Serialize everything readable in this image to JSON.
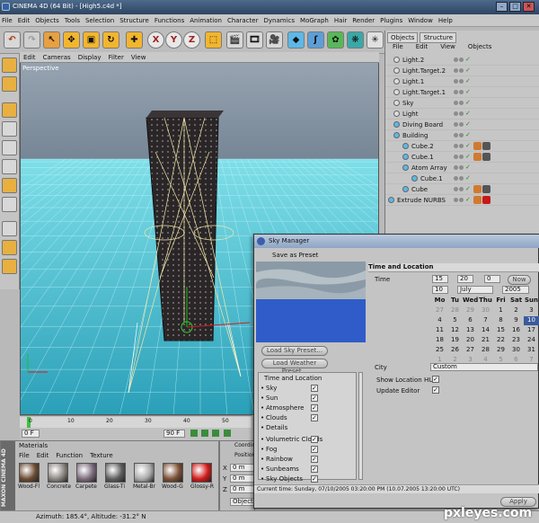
{
  "app": {
    "title": "CINEMA 4D (64 Bit) - [High5.c4d *]"
  },
  "menu": [
    "File",
    "Edit",
    "Objects",
    "Tools",
    "Selection",
    "Structure",
    "Functions",
    "Animation",
    "Character",
    "Dynamics",
    "MoGraph",
    "Hair",
    "Render",
    "Plugins",
    "Window",
    "Help"
  ],
  "toolbar": {
    "x": "X",
    "y": "Y",
    "z": "Z"
  },
  "viewport": {
    "menu": [
      "Edit",
      "Cameras",
      "Display",
      "Filter",
      "View"
    ],
    "label": "Perspective"
  },
  "objects_panel": {
    "tabs": [
      "Objects",
      "Structure"
    ],
    "menu": [
      "File",
      "Edit",
      "View",
      "Objects"
    ],
    "items": [
      {
        "name": "Light.2"
      },
      {
        "name": "Light.Target.2"
      },
      {
        "name": "Light.1"
      },
      {
        "name": "Light.Target.1"
      },
      {
        "name": "Sky"
      },
      {
        "name": "Light"
      },
      {
        "name": "Diving Board"
      },
      {
        "name": "Building"
      },
      {
        "name": "Cube.2"
      },
      {
        "name": "Cube.1"
      },
      {
        "name": "Atom Array"
      },
      {
        "name": "Cube.1"
      },
      {
        "name": "Cube"
      },
      {
        "name": "Extrude NURBS"
      }
    ]
  },
  "sky_manager": {
    "title": "Sky Manager",
    "save_preset": "Save as Preset",
    "load_sky": "Load Sky Preset...",
    "load_weather": "Load Weather Preset...",
    "section_left": "Time and Location",
    "left_items": [
      "Sky",
      "Sun",
      "Atmosphere",
      "Clouds",
      "Details"
    ],
    "left_items2": [
      "Volumetric Clouds",
      "Fog",
      "Rainbow",
      "Sunbeams",
      "Sky Objects"
    ],
    "time_loc_header": "Time and Location",
    "time_label": "Time",
    "time": {
      "h": "15",
      "m": "20",
      "s": "0"
    },
    "now_button": "Now",
    "date": {
      "day": "10",
      "month": "July",
      "year": "2005"
    },
    "weekdays": [
      "Mo",
      "Tu",
      "Wed",
      "Thu",
      "Fri",
      "Sat",
      "Sun"
    ],
    "calendar": [
      [
        "27",
        "28",
        "29",
        "30",
        "1",
        "2",
        "3"
      ],
      [
        "4",
        "5",
        "6",
        "7",
        "8",
        "9",
        "10"
      ],
      [
        "11",
        "12",
        "13",
        "14",
        "15",
        "16",
        "17"
      ],
      [
        "18",
        "19",
        "20",
        "21",
        "22",
        "23",
        "24"
      ],
      [
        "25",
        "26",
        "27",
        "28",
        "29",
        "30",
        "31"
      ],
      [
        "1",
        "2",
        "3",
        "4",
        "5",
        "6",
        "7"
      ]
    ],
    "city_label": "City",
    "city_value": "Custom",
    "show_hud": "Show Location HUD",
    "update_editor": "Update Editor",
    "current_time": "Current time:  Sunday, 07/10/2005  03:20:00 PM   (10.07.2005   13:20:00 UTC)",
    "apply": "Apply"
  },
  "timeline": {
    "ticks": [
      "0",
      "10",
      "20",
      "30",
      "40",
      "50"
    ],
    "frame_start": "0 F",
    "frame_end": "90 F"
  },
  "materials": {
    "title": "Materials",
    "menu": [
      "File",
      "Edit",
      "Function",
      "Texture"
    ],
    "items": [
      {
        "name": "Wood-Fl",
        "color": "#6a4a32"
      },
      {
        "name": "Concrete",
        "color": "#8a8580"
      },
      {
        "name": "Carpete",
        "color": "#7a6a7a"
      },
      {
        "name": "Glass-Ti",
        "color": "#5d5d5d"
      },
      {
        "name": "Metal-Br",
        "color": "#a9a9a9"
      },
      {
        "name": "Wood-G",
        "color": "#7a4e34"
      },
      {
        "name": "Glossy-R",
        "color": "#d01818"
      }
    ]
  },
  "coords": {
    "title": "Coordinates",
    "pos": "Position",
    "x": "X",
    "y": "Y",
    "z": "Z",
    "val": "0 m",
    "object": "Object",
    "size": "Size"
  },
  "status": {
    "text": "Azimuth: 185.4°, Altitude: -31.2°  N"
  },
  "watermark": "pxleyes.com",
  "brand": "MAXON CINEMA 4D",
  "colors": {
    "accent": "#4d6a8c",
    "sky": "#3a6fd0",
    "grid": "#3fd0e0"
  }
}
